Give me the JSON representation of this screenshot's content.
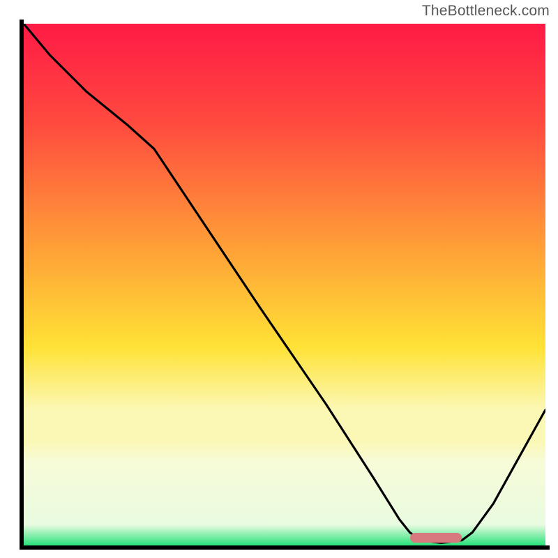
{
  "watermark": "TheBottleneck.com",
  "colors": {
    "red": "#ff1a45",
    "pink": "#ff2a4e",
    "orange": "#ff8a3a",
    "yellow": "#ffe236",
    "paleYellow": "#fbf8b5",
    "cream": "#f7fbd8",
    "green": "#28e37b",
    "marker": "#d87a7d",
    "axis": "#000000",
    "curve": "#000000"
  },
  "chart_data": {
    "type": "line",
    "title": "",
    "xlabel": "",
    "ylabel": "",
    "xlim": [
      0,
      100
    ],
    "ylim": [
      0,
      100
    ],
    "gradient_bands": [
      {
        "stop": 0,
        "color": "#ff1a45"
      },
      {
        "stop": 19,
        "color": "#ff4a3f"
      },
      {
        "stop": 43,
        "color": "#ffa037"
      },
      {
        "stop": 62,
        "color": "#ffe236"
      },
      {
        "stop": 74,
        "color": "#fbf8b5"
      },
      {
        "stop": 80,
        "color": "#fbf8b5"
      },
      {
        "stop": 84,
        "color": "#f7fbd8"
      },
      {
        "stop": 96,
        "color": "#e9fbe0"
      },
      {
        "stop": 100,
        "color": "#28e37b"
      }
    ],
    "curve": [
      {
        "x": 0,
        "y": 100
      },
      {
        "x": 5,
        "y": 94
      },
      {
        "x": 12,
        "y": 87
      },
      {
        "x": 20,
        "y": 80.5
      },
      {
        "x": 25,
        "y": 76
      },
      {
        "x": 27,
        "y": 73
      },
      {
        "x": 33,
        "y": 64
      },
      {
        "x": 45,
        "y": 46
      },
      {
        "x": 58,
        "y": 27
      },
      {
        "x": 67,
        "y": 13
      },
      {
        "x": 72,
        "y": 5
      },
      {
        "x": 74,
        "y": 2.5
      },
      {
        "x": 76,
        "y": 1
      },
      {
        "x": 80,
        "y": 0.5
      },
      {
        "x": 84,
        "y": 1
      },
      {
        "x": 86,
        "y": 2.5
      },
      {
        "x": 90,
        "y": 8
      },
      {
        "x": 95,
        "y": 17
      },
      {
        "x": 100,
        "y": 26
      }
    ],
    "marker_range": {
      "x_start": 74,
      "x_end": 84,
      "y": 1.5
    }
  }
}
